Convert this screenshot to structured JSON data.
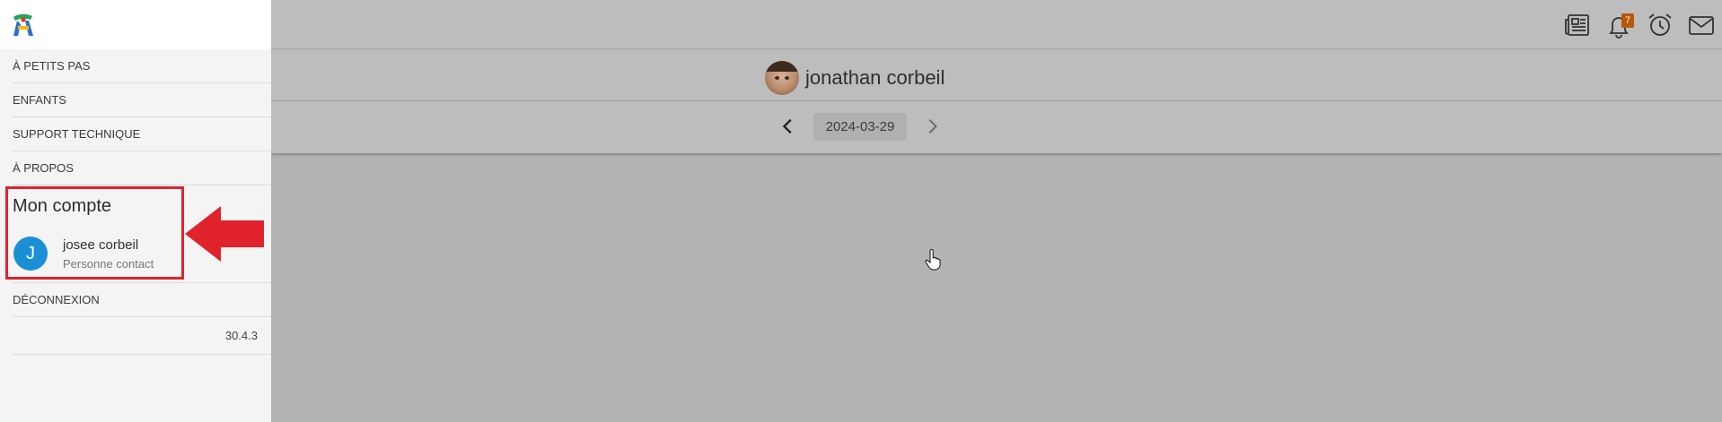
{
  "header": {
    "notification_count": "7",
    "icons": [
      "newspaper-icon",
      "bell-icon",
      "alarm-clock-icon",
      "mail-icon"
    ]
  },
  "child": {
    "name": "jonathan corbeil"
  },
  "date_nav": {
    "date": "2024-03-29"
  },
  "sidebar": {
    "items": [
      {
        "label": "À PETITS PAS"
      },
      {
        "label": "ENFANTS"
      },
      {
        "label": "SUPPORT TECHNIQUE"
      },
      {
        "label": "À PROPOS"
      }
    ],
    "account": {
      "title": "Mon compte",
      "avatar_letter": "J",
      "name": "josee corbeil",
      "role": "Personne contact"
    },
    "logout_label": "DÉCONNEXION",
    "version": "30.4.3"
  },
  "colors": {
    "highlight": "#e0222b",
    "avatar": "#1b8fd6",
    "badge": "#b8560b"
  }
}
